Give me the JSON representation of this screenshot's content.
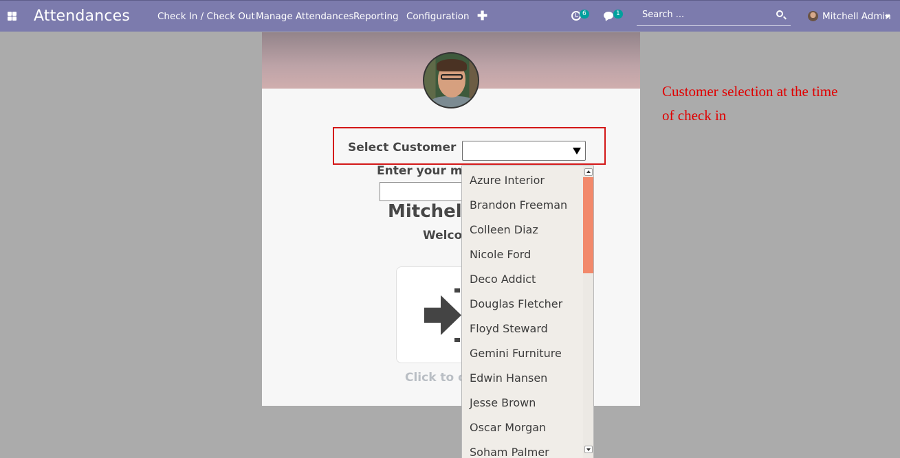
{
  "navbar": {
    "app_title": "Attendances",
    "menu": [
      "Check In / Check Out",
      "Manage Attendances",
      "Reporting",
      "Configuration"
    ],
    "activity_count": "6",
    "message_count": "1",
    "search_placeholder": "Search ...",
    "user_name": "Mitchell Admin"
  },
  "kiosk": {
    "select_customer_label": "Select Customer",
    "message_label": "Enter your mes",
    "employee_name": "Mitchell A",
    "welcome": "Welco",
    "click_hint": "Click to ch"
  },
  "dropdown": {
    "options": [
      "Azure Interior",
      "Brandon Freeman",
      "Colleen Diaz",
      "Nicole Ford",
      "Deco Addict",
      "Douglas Fletcher",
      "Floyd Steward",
      "Gemini Furniture",
      "Edwin Hansen",
      "Jesse Brown",
      "Oscar Morgan",
      "Soham Palmer"
    ]
  },
  "annotation": "Customer selection at the time of check in",
  "colors": {
    "navbar": "#7c7bad",
    "accent_frame": "#d31717",
    "scroll_thumb": "#f2896b",
    "badge": "#00a09d",
    "annotation": "#e00000"
  }
}
